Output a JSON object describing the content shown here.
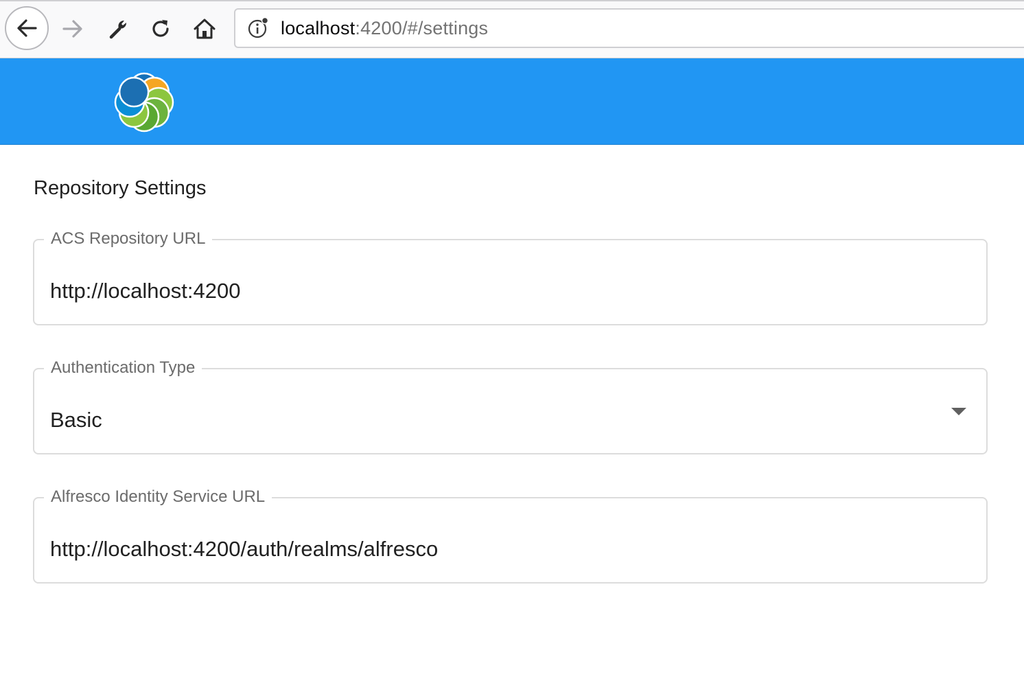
{
  "browser": {
    "url_host": "localhost",
    "url_path": ":4200/#/settings",
    "icons": [
      "back-arrow-icon",
      "forward-arrow-icon",
      "wrench-icon",
      "reload-icon",
      "home-icon",
      "info-icon"
    ]
  },
  "header": {
    "logo": "alfresco-logo",
    "color": "#2196f3"
  },
  "settings": {
    "title": "Repository Settings",
    "fields": [
      {
        "label": "ACS Repository URL",
        "value": "http://localhost:4200"
      },
      {
        "label": "Authentication Type",
        "value": "Basic"
      },
      {
        "label": "Alfresco Identity Service URL",
        "value": "http://localhost:4200/auth/realms/alfresco"
      }
    ]
  }
}
